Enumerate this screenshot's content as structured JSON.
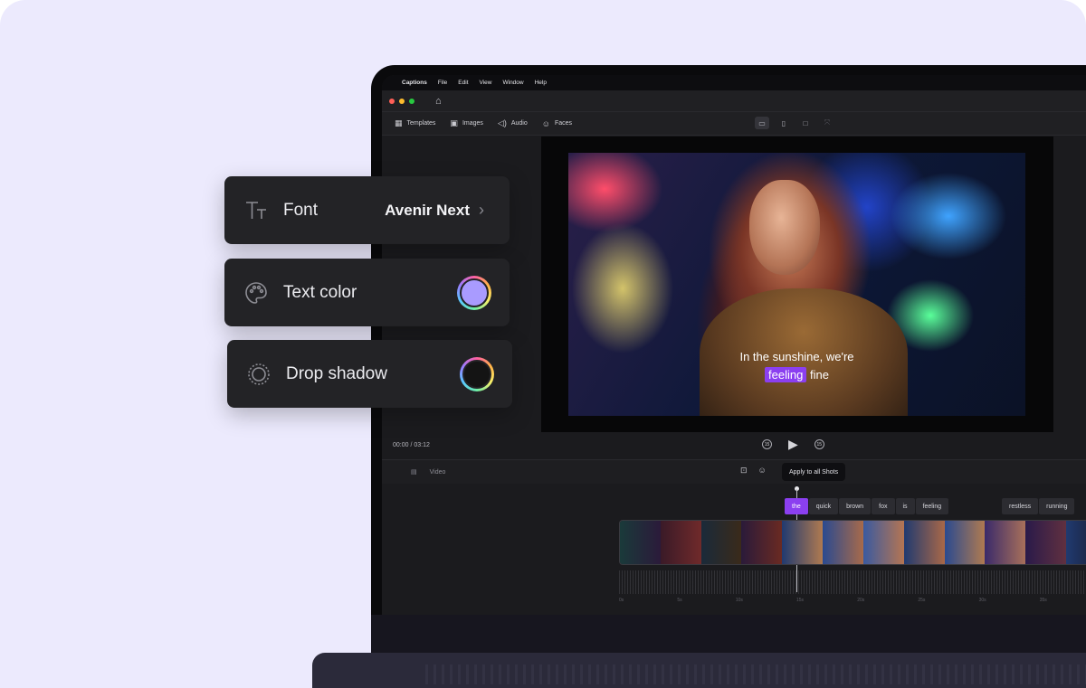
{
  "menubar": {
    "apple_glyph": "",
    "items": [
      "Captions",
      "File",
      "Edit",
      "View",
      "Window",
      "Help"
    ]
  },
  "toolbar": {
    "tools": [
      {
        "label": "Templates",
        "icon": "templates-icon"
      },
      {
        "label": "Images",
        "icon": "image-icon"
      },
      {
        "label": "Audio",
        "icon": "audio-icon"
      },
      {
        "label": "Faces",
        "icon": "faces-icon"
      }
    ]
  },
  "preview": {
    "caption_line1": "In the sunshine, we're",
    "caption_highlight": "feeling",
    "caption_rest": "fine"
  },
  "playback": {
    "timecode": "00:00 / 03:12",
    "rewind_label": "15",
    "forward_label": "15"
  },
  "timeline": {
    "track_label": "Video",
    "apply_button": "Apply to all Shots",
    "words": [
      "the",
      "quick",
      "brown",
      "fox",
      "is",
      "feeling"
    ],
    "words_later": [
      "restless",
      "running"
    ],
    "active_word_index": 0,
    "ticks": [
      "0s",
      "5s",
      "10s",
      "15s",
      "20s",
      "25s",
      "30s",
      "35s",
      "40s"
    ]
  },
  "panels": {
    "font": {
      "label": "Font",
      "value": "Avenir Next"
    },
    "text_color": {
      "label": "Text color",
      "color": "#A99BFF"
    },
    "drop_shadow": {
      "label": "Drop shadow",
      "color": "#141414"
    }
  },
  "colors": {
    "accent": "#8B3FF0",
    "background": "#ECEAFD",
    "panel": "#232326"
  }
}
